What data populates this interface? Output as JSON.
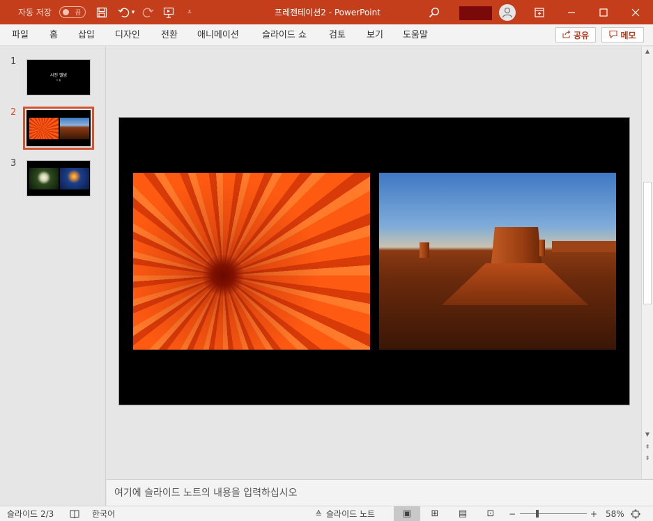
{
  "titlebar": {
    "autosave_label": "자동 저장",
    "autosave_state": "끔",
    "doc_title": "프레젠테이션2  -  PowerPoint",
    "icons": [
      "save-icon",
      "undo-icon",
      "redo-icon",
      "present-icon",
      "customize-icon",
      "search-icon",
      "ribbon-display-icon",
      "minimize-icon",
      "maximize-icon",
      "close-icon"
    ]
  },
  "menu": {
    "tabs": [
      "파일",
      "홈",
      "삽입",
      "디자인",
      "전환",
      "애니메이션",
      "슬라이드 쇼",
      "검토",
      "보기",
      "도움말"
    ],
    "share_label": "공유",
    "memo_label": "메모"
  },
  "thumbnails": {
    "items": [
      {
        "num": "1",
        "title": "사진 앨범",
        "subtitle": "이 름"
      },
      {
        "num": "2"
      },
      {
        "num": "3"
      }
    ],
    "selected": "2"
  },
  "notes": {
    "placeholder": "여기에 슬라이드 노트의 내용을 입력하십시오"
  },
  "status": {
    "slide_pos": "슬라이드 2/3",
    "language": "한국어",
    "notes_label": "슬라이드 노트",
    "zoom": "58%",
    "zoom_minus": "−",
    "zoom_plus": "+"
  },
  "colors": {
    "accent": "#c43e1c",
    "selection": "#d35230"
  }
}
